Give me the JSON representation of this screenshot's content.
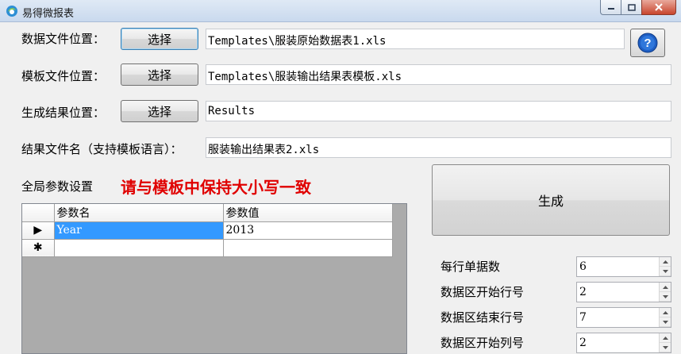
{
  "window": {
    "title": "易得微报表",
    "controls": {
      "minimize": "–",
      "maximize": "□",
      "close": "✕"
    }
  },
  "form": {
    "data_file_label": "数据文件位置：",
    "data_file_value": "Templates\\服装原始数据表1.xls",
    "template_file_label": "模板文件位置：",
    "template_file_value": "Templates\\服装输出结果表模板.xls",
    "output_dir_label": "生成结果位置：",
    "output_dir_value": "Results",
    "result_name_label": "结果文件名（支持模板语言）：",
    "result_name_value": "服装输出结果表2.xls",
    "select_button": "选择",
    "help_button": "?"
  },
  "params": {
    "section_label": "全局参数设置",
    "warning": "请与模板中保持大小写一致",
    "columns": [
      "参数名",
      "参数值"
    ],
    "rows": [
      {
        "marker": "▶",
        "name": "Year",
        "value": "2013"
      },
      {
        "marker": "✱",
        "name": "",
        "value": ""
      }
    ]
  },
  "generate_button": "生成",
  "settings": [
    {
      "label": "每行单据数",
      "value": "6"
    },
    {
      "label": "数据区开始行号",
      "value": "2"
    },
    {
      "label": "数据区结束行号",
      "value": "7"
    },
    {
      "label": "数据区开始列号",
      "value": "2"
    }
  ],
  "colors": {
    "accent": "#3399ff",
    "warning": "#e00000",
    "help": "#1f5fc4"
  }
}
